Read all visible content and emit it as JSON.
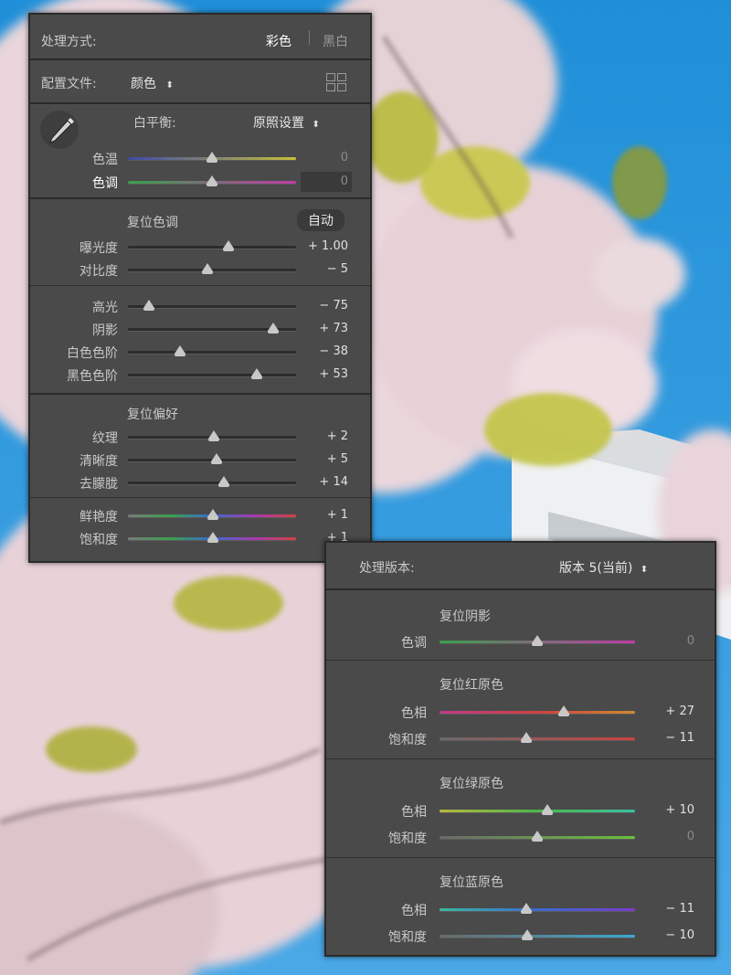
{
  "basic_panel": {
    "treatment_label": "处理方式:",
    "treatment_color": "彩色",
    "treatment_bw": "黑白",
    "profile_label": "配置文件:",
    "profile_value": "颜色",
    "white_balance_label": "白平衡:",
    "white_balance_value": "原照设置",
    "sliders_wb": [
      {
        "label": "色温",
        "value": "0",
        "pos": 0.5,
        "gradient": [
          "#3d4aa8",
          "#c6bf3a"
        ],
        "dim": true
      },
      {
        "label": "色调",
        "value": "0",
        "pos": 0.5,
        "gradient": [
          "#3aa04a",
          "#c23aa8"
        ],
        "dim": true,
        "active": true
      }
    ],
    "tone_header": "复位色调",
    "auto_button": "自动",
    "sliders_tone1": [
      {
        "label": "曝光度",
        "value": "+ 1.00",
        "pos": 0.6
      },
      {
        "label": "对比度",
        "value": "− 5",
        "pos": 0.475
      }
    ],
    "sliders_tone2": [
      {
        "label": "高光",
        "value": "− 75",
        "pos": 0.125
      },
      {
        "label": "阴影",
        "value": "+ 73",
        "pos": 0.865
      },
      {
        "label": "白色色阶",
        "value": "− 38",
        "pos": 0.31
      },
      {
        "label": "黑色色阶",
        "value": "+ 53",
        "pos": 0.765
      }
    ],
    "presence_header": "复位偏好",
    "sliders_presence": [
      {
        "label": "纹理",
        "value": "+ 2",
        "pos": 0.51
      },
      {
        "label": "清晰度",
        "value": "+ 5",
        "pos": 0.525
      },
      {
        "label": "去朦胧",
        "value": "+ 14",
        "pos": 0.57
      }
    ],
    "sliders_vib": [
      {
        "label": "鲜艳度",
        "value": "+ 1",
        "pos": 0.505,
        "gradient": [
          "#7a7a7a",
          "#3aa04a",
          "#3a6ad0",
          "#a83ab0",
          "#d04040"
        ]
      },
      {
        "label": "饱和度",
        "value": "+ 1",
        "pos": 0.505,
        "gradient": [
          "#7a7a7a",
          "#3aa04a",
          "#3a6ad0",
          "#a83ab0",
          "#d04040"
        ]
      }
    ]
  },
  "calibration_panel": {
    "process_label": "处理版本:",
    "process_value": "版本 5(当前)",
    "shadows_header": "复位阴影",
    "shadow_slider": {
      "label": "色调",
      "value": "0",
      "pos": 0.5,
      "gradient": [
        "#3aa04a",
        "#c23aa8"
      ],
      "dim": true
    },
    "red_header": "复位红原色",
    "red_sliders": [
      {
        "label": "色相",
        "value": "+ 27",
        "pos": 0.635,
        "gradient": [
          "#c03a8a",
          "#d04040",
          "#d08a30"
        ]
      },
      {
        "label": "饱和度",
        "value": "− 11",
        "pos": 0.445,
        "gradient": [
          "#6a6a6a",
          "#d04040"
        ]
      }
    ],
    "green_header": "复位绿原色",
    "green_sliders": [
      {
        "label": "色相",
        "value": "+ 10",
        "pos": 0.55,
        "gradient": [
          "#b8b83a",
          "#4ab84a",
          "#3ac0a0"
        ]
      },
      {
        "label": "饱和度",
        "value": "0",
        "pos": 0.5,
        "gradient": [
          "#6a6a6a",
          "#6ac03a"
        ],
        "dim": true
      }
    ],
    "blue_header": "复位蓝原色",
    "blue_sliders": [
      {
        "label": "色相",
        "value": "− 11",
        "pos": 0.445,
        "gradient": [
          "#3ab8a0",
          "#3a6ad0",
          "#7a3ad0"
        ]
      },
      {
        "label": "饱和度",
        "value": "− 10",
        "pos": 0.45,
        "gradient": [
          "#6a6a6a",
          "#3aa8d0"
        ]
      }
    ]
  }
}
